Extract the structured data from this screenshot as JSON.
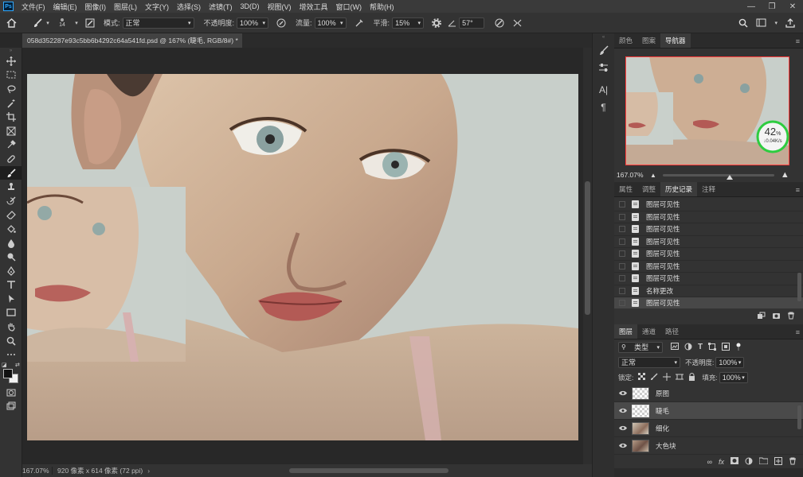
{
  "menu": {
    "logo": "Ps",
    "items": [
      "文件(F)",
      "编辑(E)",
      "图像(I)",
      "图层(L)",
      "文字(Y)",
      "选择(S)",
      "滤镜(T)",
      "3D(D)",
      "视图(V)",
      "增效工具",
      "窗口(W)",
      "帮助(H)"
    ]
  },
  "options": {
    "brush_size": "14",
    "mode_label": "模式:",
    "mode_value": "正常",
    "opacity_label": "不透明度:",
    "opacity_value": "100%",
    "flow_label": "流量:",
    "flow_value": "100%",
    "smoothing_label": "平滑:",
    "smoothing_value": "15%",
    "angle_value": "57°"
  },
  "document": {
    "tab_title": "058d352287e93c5bb6b4292c64a541fd.psd @ 167% (睫毛, RGB/8#) *",
    "zoom": "167.07%",
    "size_info": "920 像素 x 614 像素 (72 ppi)"
  },
  "navigator": {
    "tabs": [
      "颜色",
      "图案",
      "导航器"
    ],
    "active_tab": 2,
    "zoom": "167.07%",
    "zoom_slider_level": 0.6,
    "cpu_percent": "42",
    "cpu_unit": "%",
    "cpu_speed": "0.04K/s"
  },
  "history": {
    "tabs": [
      "属性",
      "调整",
      "历史记录",
      "注释"
    ],
    "active_tab": 2,
    "items": [
      "图层可见性",
      "图层可见性",
      "图层可见性",
      "图层可见性",
      "图层可见性",
      "图层可见性",
      "图层可见性",
      "名称更改",
      "图层可见性"
    ],
    "selected_index": 8
  },
  "layers": {
    "tabs": [
      "图层",
      "通道",
      "路径"
    ],
    "active_tab": 0,
    "filter_label": "类型",
    "blend_mode": "正常",
    "opacity_label": "不透明度:",
    "opacity_value": "100%",
    "lock_label": "锁定:",
    "fill_label": "填充:",
    "fill_value": "100%",
    "items": [
      {
        "name": "原图",
        "thumb": "transparent"
      },
      {
        "name": "睫毛",
        "thumb": "transparent"
      },
      {
        "name": "细化",
        "thumb": "image"
      },
      {
        "name": "大色块",
        "thumb": "image"
      }
    ],
    "selected_index": 1
  },
  "colors": {
    "accent": "#31a8ff",
    "navigator_frame": "#ff3b3b",
    "cpu_ring": "#2ecc40"
  },
  "tools": [
    "move-icon",
    "marquee-icon",
    "lasso-icon",
    "quick-select-icon",
    "crop-icon",
    "frame-icon",
    "eyedropper-icon",
    "healing-icon",
    "brush-icon",
    "stamp-icon",
    "history-brush-icon",
    "eraser-icon",
    "paint-bucket-icon",
    "blur-icon",
    "dodge-icon",
    "pen-icon",
    "type-icon",
    "path-select-icon",
    "rectangle-icon",
    "hand-icon",
    "zoom-icon",
    "more-icon"
  ]
}
